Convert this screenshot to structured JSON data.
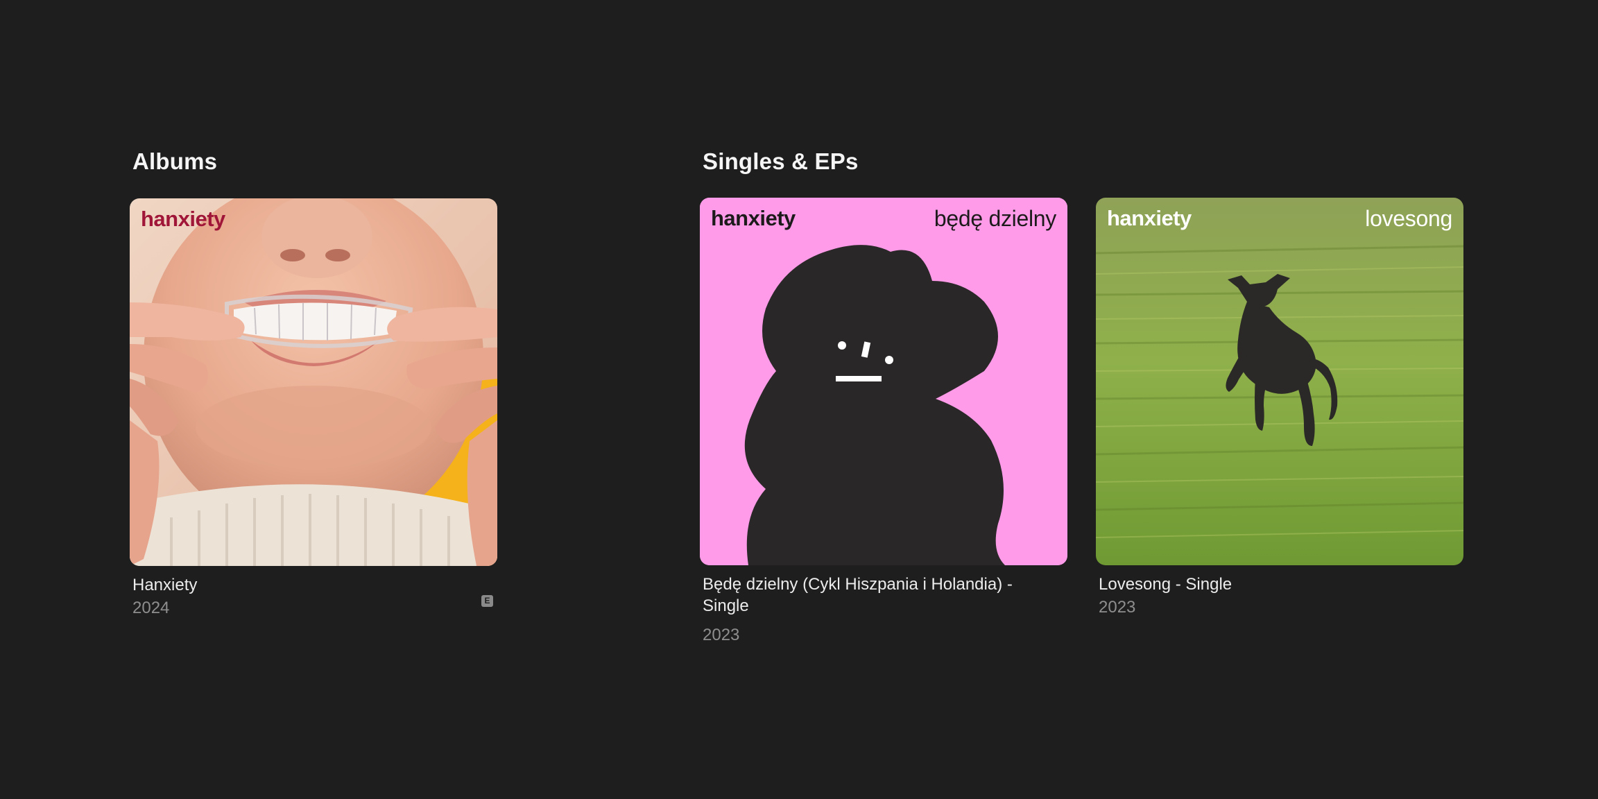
{
  "albums": {
    "heading": "Albums",
    "items": [
      {
        "title": "Hanxiety",
        "year": "2024",
        "explicit_badge": "E",
        "cover_artist": "hanxiety",
        "cover_artist_color": "#a01638"
      }
    ]
  },
  "singles": {
    "heading": "Singles & EPs",
    "items": [
      {
        "title": "Będę dzielny (Cykl Hiszpania i Holandia) - Single",
        "year": "2023",
        "cover_artist": "hanxiety",
        "cover_title": "będę dzielny",
        "cover_bg": "#ff9be8"
      },
      {
        "title": "Lovesong - Single",
        "year": "2023",
        "cover_artist": "hanxiety",
        "cover_title": "lovesong"
      }
    ]
  },
  "colors": {
    "background": "#1e1e1e",
    "title_text": "#ececec",
    "year_text": "#8e8e8e"
  }
}
